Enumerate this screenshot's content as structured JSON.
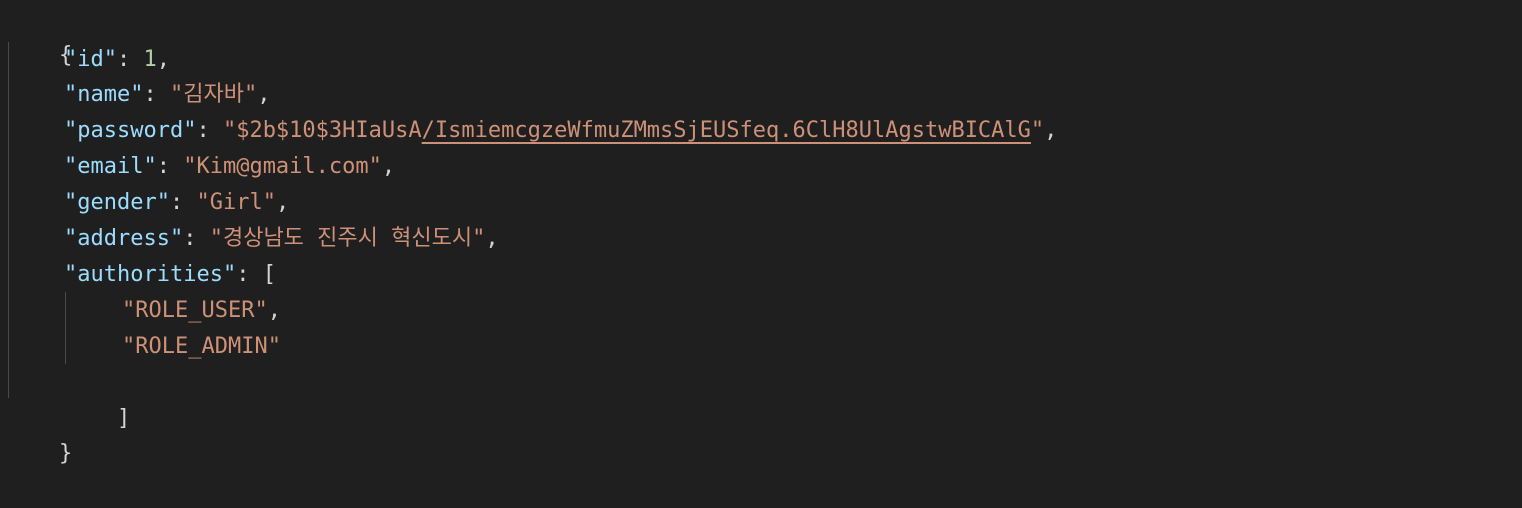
{
  "json": {
    "open_brace": "{",
    "close_brace": "}",
    "fields": {
      "id": {
        "key": "\"id\"",
        "sep": ": ",
        "value": "1",
        "trail": ","
      },
      "name": {
        "key": "\"name\"",
        "sep": ": ",
        "value": "\"김자바\"",
        "trail": ","
      },
      "password": {
        "key": "\"password\"",
        "sep": ": ",
        "value_prefix": "\"$2b$10$3HIaUsA",
        "value_link": "/IsmiemcgzeWfmuZMmsSjEUSfeq.6ClH8UlAgstwBICAlG",
        "value_suffix": "\"",
        "trail": ","
      },
      "email": {
        "key": "\"email\"",
        "sep": ": ",
        "value": "\"Kim@gmail.com\"",
        "trail": ","
      },
      "gender": {
        "key": "\"gender\"",
        "sep": ": ",
        "value": "\"Girl\"",
        "trail": ","
      },
      "address": {
        "key": "\"address\"",
        "sep": ": ",
        "value": "\"경상남도 진주시 혁신도시\"",
        "trail": ","
      },
      "authorities": {
        "key": "\"authorities\"",
        "sep": ": ",
        "open": "[",
        "close": "]"
      }
    },
    "authorities": [
      {
        "value": "\"ROLE_USER\"",
        "trail": ","
      },
      {
        "value": "\"ROLE_ADMIN\"",
        "trail": ""
      }
    ]
  },
  "colors": {
    "background": "#1f1f1f",
    "key": "#9cdcfe",
    "string": "#ce9178",
    "number": "#b5cea8",
    "punctuation": "#d4d4d4",
    "indent_guide": "#4a4a4a"
  }
}
